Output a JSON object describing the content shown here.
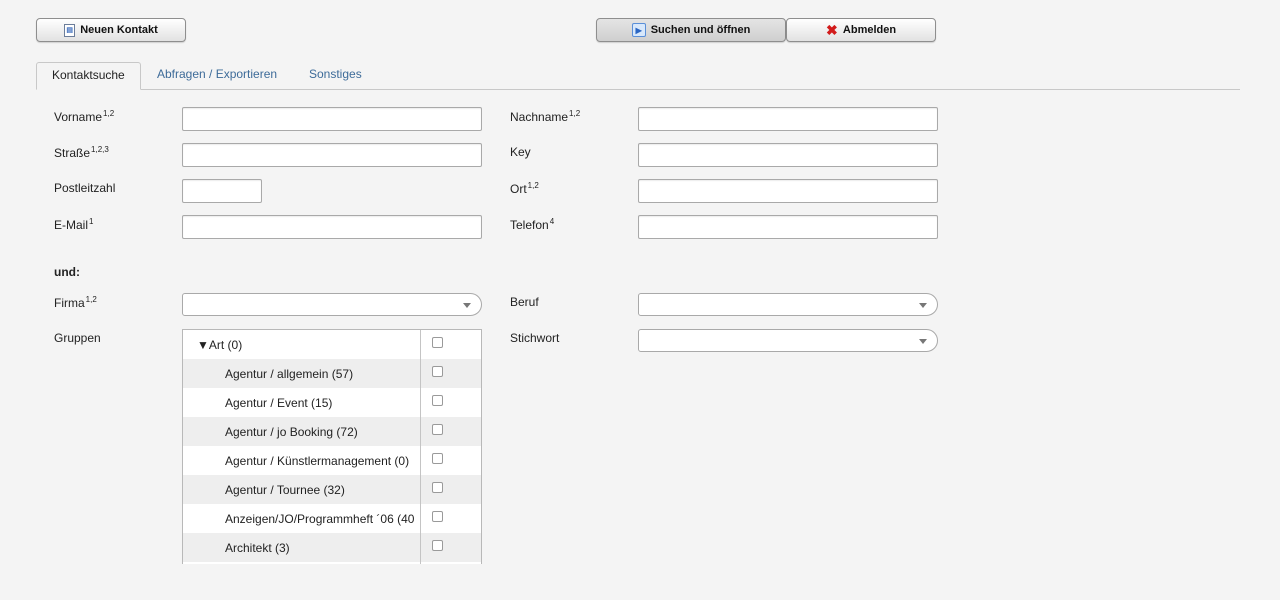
{
  "toolbar": {
    "new_contact_label": "Neuen Kontakt",
    "search_open_label": "Suchen und öffnen",
    "logout_label": "Abmelden"
  },
  "tabs": [
    {
      "label": "Kontaktsuche",
      "active": true
    },
    {
      "label": "Abfragen / Exportieren",
      "active": false
    },
    {
      "label": "Sonstiges",
      "active": false
    }
  ],
  "form": {
    "vorname": {
      "label": "Vorname",
      "sup": "1,2",
      "value": ""
    },
    "nachname": {
      "label": "Nachname",
      "sup": "1,2",
      "value": ""
    },
    "strasse": {
      "label": "Straße",
      "sup": "1,2,3",
      "value": ""
    },
    "key": {
      "label": "Key",
      "value": ""
    },
    "plz": {
      "label": "Postleitzahl",
      "value": ""
    },
    "ort": {
      "label": "Ort",
      "sup": "1,2",
      "value": ""
    },
    "email": {
      "label": "E-Mail",
      "sup": "1",
      "value": ""
    },
    "telefon": {
      "label": "Telefon",
      "sup": "4",
      "value": ""
    },
    "und_label": "und:",
    "firma": {
      "label": "Firma",
      "sup": "1,2",
      "value": ""
    },
    "beruf": {
      "label": "Beruf",
      "value": ""
    },
    "gruppen": {
      "label": "Gruppen"
    },
    "stichwort": {
      "label": "Stichwort",
      "value": ""
    }
  },
  "groups": [
    {
      "label": "Art (0)",
      "expanded": true,
      "toggle": "▼",
      "checked": false
    },
    {
      "label": "Agentur / allgemein (57)",
      "checked": false
    },
    {
      "label": "Agentur / Event (15)",
      "checked": false
    },
    {
      "label": "Agentur / jo Booking (72)",
      "checked": false
    },
    {
      "label": "Agentur / Künstlermanagement (0)",
      "checked": false
    },
    {
      "label": "Agentur / Tournee (32)",
      "checked": false
    },
    {
      "label": "Anzeigen/JO/Programmheft ´06 (40",
      "checked": false
    },
    {
      "label": "Architekt (3)",
      "checked": false
    }
  ],
  "icons": {
    "new_contact": "new-contact-icon",
    "search_open": "arrow-right-icon",
    "logout": "red-x-icon"
  },
  "colors": {
    "background": "#f4f4f4",
    "tab_link": "#3d6b99",
    "logout_icon": "#d21b1b"
  }
}
